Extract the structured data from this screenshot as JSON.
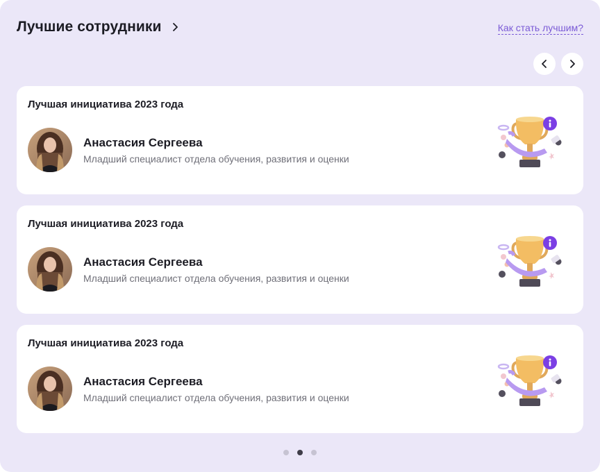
{
  "header": {
    "title": "Лучшие сотрудники",
    "help_link": "Как стать лучшим?"
  },
  "nav": {
    "prev_icon": "chevron-left-icon",
    "next_icon": "chevron-right-icon"
  },
  "cards": [
    {
      "award": "Лучшая инициатива 2023 года",
      "name": "Анастасия Сергеева",
      "role": "Младший специалист отдела обучения, развития и оценки"
    },
    {
      "award": "Лучшая инициатива 2023 года",
      "name": "Анастасия Сергеева",
      "role": "Младший специалист отдела обучения, развития и оценки"
    },
    {
      "award": "Лучшая инициатива 2023 года",
      "name": "Анастасия Сергеева",
      "role": "Младший специалист отдела обучения, развития и оценки"
    }
  ],
  "pagination": {
    "count": 3,
    "active_index": 1
  },
  "colors": {
    "background": "#ebe7f8",
    "accent": "#7b3fe4",
    "link": "#7a5ad6",
    "dot_active": "#3f3d49",
    "dot_inactive": "#c6c3d2"
  }
}
